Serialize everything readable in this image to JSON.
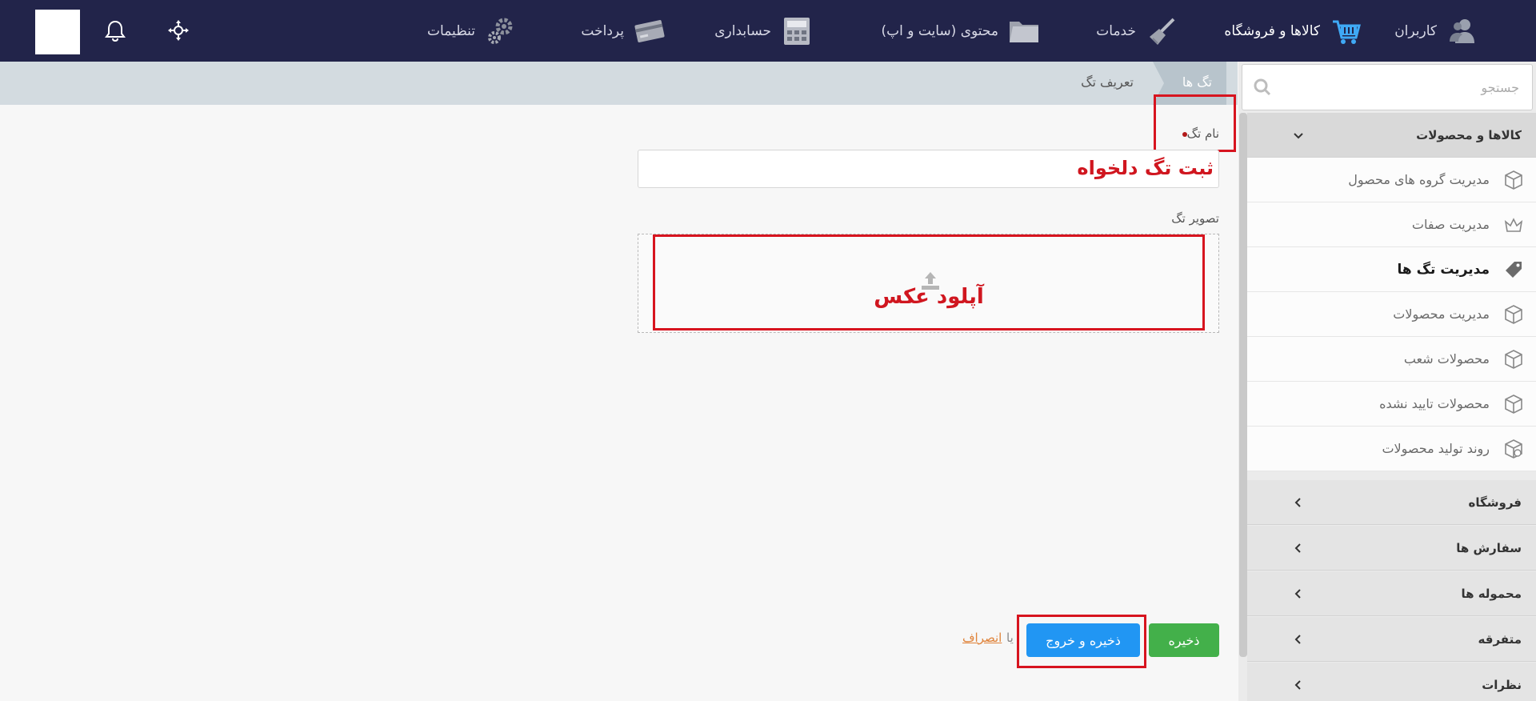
{
  "topnav": {
    "items": [
      {
        "label": "کاربران",
        "icon": "users-icon"
      },
      {
        "label": "کالاها و فروشگاه",
        "icon": "shopping-cart-icon"
      },
      {
        "label": "خدمات",
        "icon": "broom-icon"
      },
      {
        "label": "محتوی (سایت و اپ)",
        "icon": "folder-icon"
      },
      {
        "label": "حسابداری",
        "icon": "calculator-icon"
      },
      {
        "label": "پرداخت",
        "icon": "credit-card-icon"
      },
      {
        "label": "تنظیمات",
        "icon": "gears-icon"
      }
    ],
    "active": "کالاها و فروشگاه"
  },
  "sidebar": {
    "search_placeholder": "جستجو",
    "sections": [
      {
        "label": "کالاها و محصولات",
        "expanded": true
      },
      {
        "label": "فروشگاه"
      },
      {
        "label": "سفارش ها"
      },
      {
        "label": "محموله ها"
      },
      {
        "label": "متفرقه"
      },
      {
        "label": "نظرات"
      }
    ],
    "items": [
      {
        "label": "مدیریت گروه های محصول",
        "icon": "box-icon"
      },
      {
        "label": "مدیریت صفات",
        "icon": "crown-icon"
      },
      {
        "label": "مدیریت تگ ها",
        "icon": "tag-icon",
        "active": true
      },
      {
        "label": "مدیریت محصولات",
        "icon": "box-icon"
      },
      {
        "label": "محصولات شعب",
        "icon": "box-icon"
      },
      {
        "label": "محصولات تایید نشده",
        "icon": "box-icon"
      },
      {
        "label": "روند تولید محصولات",
        "icon": "box-process-icon"
      }
    ]
  },
  "breadcrumb": {
    "current": "تگ ها",
    "next": "تعریف تگ"
  },
  "form": {
    "tag_name_label": "نام تگ",
    "tag_name_value": "ثبت تگ دلخواه",
    "tag_image_label": "تصویر تگ",
    "upload_text": "آپلود عکس"
  },
  "actions": {
    "save": "ذخیره",
    "save_exit": "ذخیره و خروج",
    "or": "یا",
    "cancel": "انصراف"
  },
  "colors": {
    "nav_bg": "#22244a",
    "highlight": "#d7141f",
    "save": "#43b04a",
    "save_exit": "#2196f3",
    "active_marker": "#e8a236"
  }
}
